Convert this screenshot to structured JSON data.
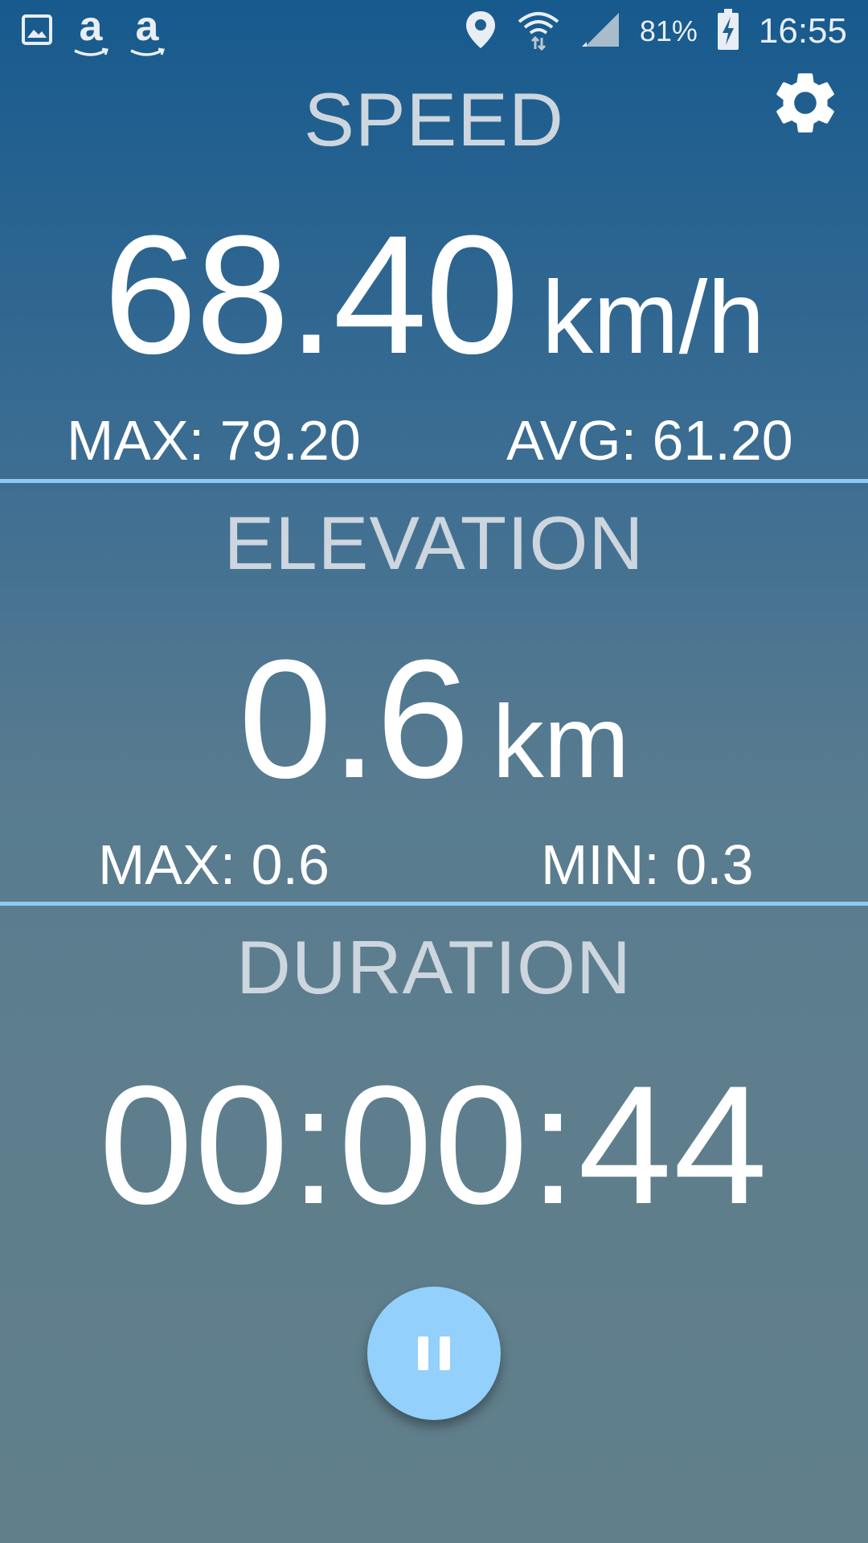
{
  "status_bar": {
    "left_icons": [
      "image-icon",
      "amazon-icon",
      "amazon-icon"
    ],
    "amazon_glyph": "a",
    "right_icons": [
      "location-icon",
      "wifi-icon",
      "signal-icon",
      "battery-charging-icon"
    ],
    "battery_percent": "81%",
    "time": "16:55"
  },
  "settings": {
    "icon": "gear-icon"
  },
  "speed": {
    "title": "SPEED",
    "value": "68.40",
    "unit": "km/h",
    "max": "MAX: 79.20",
    "avg": "AVG: 61.20"
  },
  "elevation": {
    "title": "ELEVATION",
    "value": "0.6",
    "unit": "km",
    "max": "MAX: 0.6",
    "min": "MIN: 0.3"
  },
  "duration": {
    "title": "DURATION",
    "value": "00:00:44"
  },
  "controls": {
    "pause_icon": "pause-icon"
  },
  "colors": {
    "divider": "#8ccaf4",
    "fab": "#93d0fb",
    "title_text": "#cdd6de",
    "gradient_top": "#175a8e",
    "gradient_bottom": "#617f8b"
  }
}
